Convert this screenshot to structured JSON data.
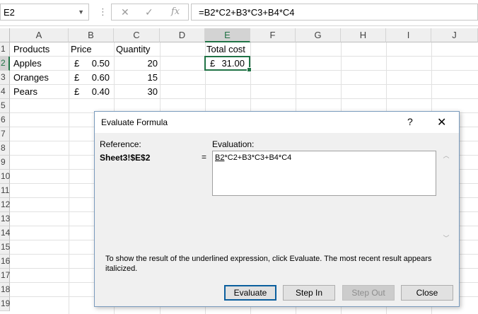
{
  "formula_bar": {
    "name_box": "E2",
    "separator": "⋮",
    "cancel_glyph": "✕",
    "enter_glyph": "✓",
    "fx_label": "fx",
    "formula": "=B2*C2+B3*C3+B4*C4"
  },
  "sheet": {
    "columns": [
      "A",
      "B",
      "C",
      "D",
      "E",
      "F",
      "G",
      "H",
      "I",
      "J"
    ],
    "rows": [
      "1",
      "2",
      "3",
      "4",
      "5",
      "6",
      "7",
      "8",
      "9",
      "10",
      "11",
      "12",
      "13",
      "14",
      "15",
      "16",
      "17",
      "18",
      "19"
    ],
    "selected_column": "E",
    "selected_row": "2",
    "cells": {
      "A1": "Products",
      "B1": "Price",
      "C1": "Quantity",
      "E1": "Total cost",
      "A2": "Apples",
      "B2_symbol": "£",
      "B2_value": "0.50",
      "C2": "20",
      "A3": "Oranges",
      "B3_symbol": "£",
      "B3_value": "0.60",
      "C3": "15",
      "A4": "Pears",
      "B4_symbol": "£",
      "B4_value": "0.40",
      "C4": "30",
      "E2_symbol": "£",
      "E2_value": "31.00"
    }
  },
  "dialog": {
    "title": "Evaluate Formula",
    "help_glyph": "?",
    "close_glyph": "✕",
    "reference_label": "Reference:",
    "reference_value": "Sheet3!$E$2",
    "equals": "=",
    "evaluation_label": "Evaluation:",
    "evaluation_underlined": "B2",
    "evaluation_rest": "*C2+B3*C3+B4*C4",
    "help_text": "To show the result of the underlined expression, click Evaluate.  The most recent result appears italicized.",
    "buttons": {
      "evaluate": "Evaluate",
      "step_in": "Step In",
      "step_out": "Step Out",
      "close": "Close"
    }
  },
  "colors": {
    "excel_green": "#217346",
    "default_button_border": "#0b5f9e"
  }
}
